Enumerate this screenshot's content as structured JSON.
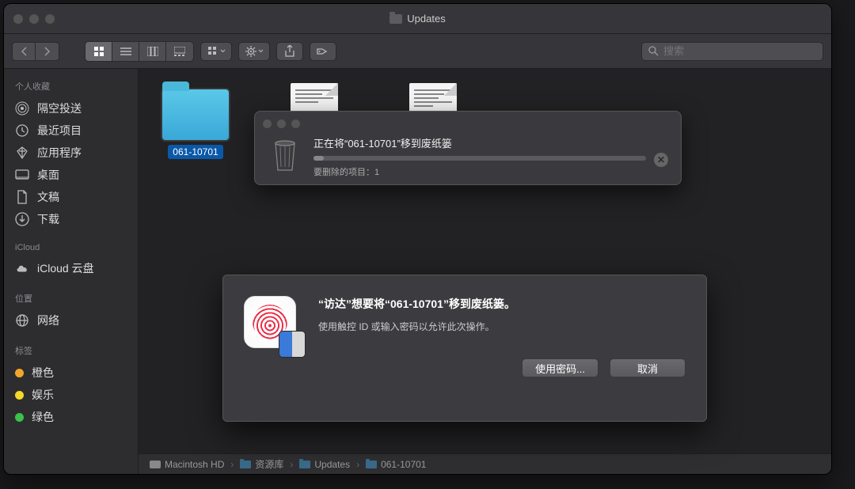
{
  "window": {
    "title": "Updates"
  },
  "toolbar": {
    "search_placeholder": "搜索"
  },
  "sidebar": {
    "favorites_header": "个人收藏",
    "icloud_header": "iCloud",
    "locations_header": "位置",
    "tags_header": "标签",
    "favorites": [
      {
        "label": "隔空投送",
        "icon": "airdrop"
      },
      {
        "label": "最近项目",
        "icon": "clock"
      },
      {
        "label": "应用程序",
        "icon": "apps"
      },
      {
        "label": "桌面",
        "icon": "desktop"
      },
      {
        "label": "文稿",
        "icon": "documents"
      },
      {
        "label": "下载",
        "icon": "downloads"
      }
    ],
    "icloud": [
      {
        "label": "iCloud 云盘",
        "icon": "cloud"
      }
    ],
    "locations": [
      {
        "label": "网络",
        "icon": "network"
      }
    ],
    "tags": [
      {
        "label": "橙色",
        "color": "#f4a62a"
      },
      {
        "label": "娱乐",
        "color": "#f4d82a"
      },
      {
        "label": "绿色",
        "color": "#3ac24a"
      }
    ]
  },
  "files": {
    "item0": {
      "name": "061-10701"
    }
  },
  "path": {
    "p0": "Macintosh HD",
    "p1": "资源库",
    "p2": "Updates",
    "p3": "061-10701"
  },
  "progress": {
    "title": "正在将“061-10701”移到废纸篓",
    "sub": "要删除的项目：1"
  },
  "auth": {
    "title": "“访达”想要将“061-10701”移到废纸篓。",
    "sub": "使用触控 ID 或输入密码以允许此次操作。",
    "btn_pwd": "使用密码...",
    "btn_cancel": "取消"
  }
}
